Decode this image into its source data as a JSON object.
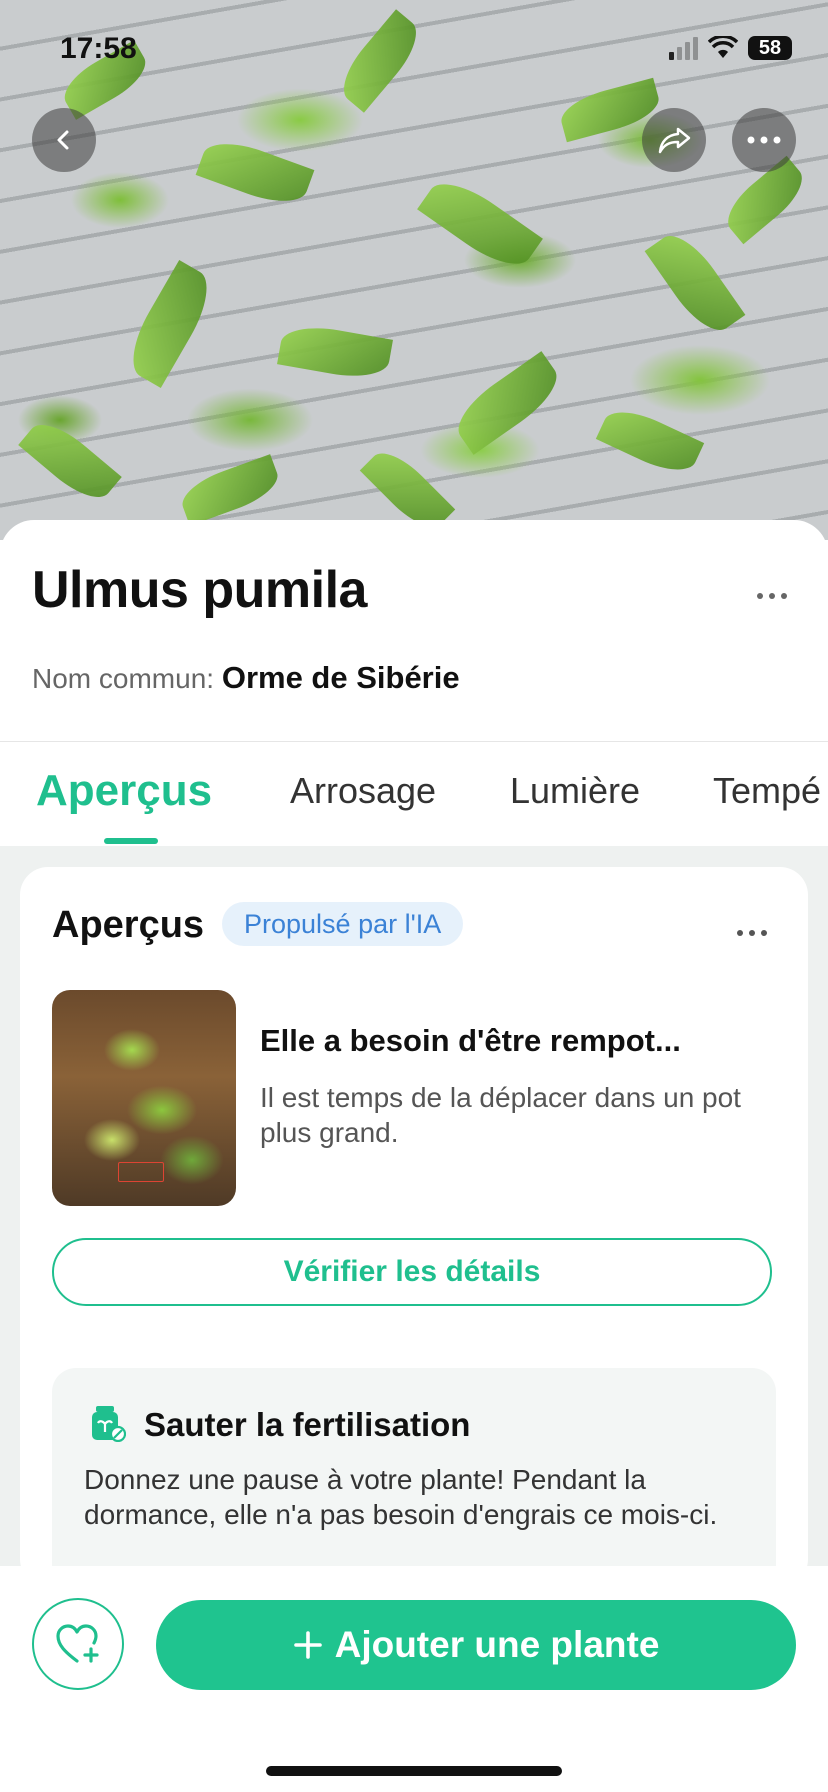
{
  "status": {
    "time": "17:58",
    "battery": "58"
  },
  "plant": {
    "scientific_name": "Ulmus pumila",
    "common_label": "Nom commun:",
    "common_name": "Orme de Sibérie"
  },
  "tabs": [
    {
      "label": "Aperçus",
      "active": true
    },
    {
      "label": "Arrosage"
    },
    {
      "label": "Lumière"
    },
    {
      "label": "Tempé"
    }
  ],
  "insights": {
    "title": "Aperçus",
    "ai_badge": "Propulsé par l'IA",
    "item": {
      "headline": "Elle a besoin d'être rempot...",
      "body": "Il est temps de la déplacer dans un pot plus grand."
    },
    "verify_button": "Vérifier les détails",
    "tip": {
      "title": "Sauter la fertilisation",
      "body": "Donnez une pause à votre plante! Pendant la dormance, elle n'a pas besoin d'engrais ce mois-ci."
    }
  },
  "actions": {
    "add_plant": "Ajouter une plante"
  },
  "colors": {
    "accent": "#1fbf8e",
    "ai_badge_bg": "#e6f1fb",
    "ai_badge_text": "#3b82d6"
  },
  "icons": [
    "back-icon",
    "share-icon",
    "more-icon",
    "fertilizer-icon",
    "heart-plus-icon",
    "plus-icon"
  ]
}
